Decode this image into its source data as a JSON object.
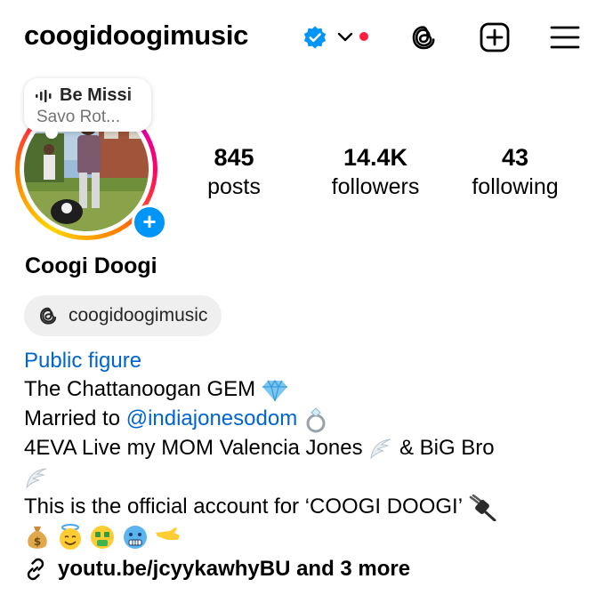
{
  "header": {
    "username": "coogidoogimusic",
    "icons": [
      "verified-badge-icon",
      "chevron-down-icon",
      "notification-dot",
      "threads-icon",
      "create-post-icon",
      "menu-icon"
    ]
  },
  "note": {
    "title": "Be Missi",
    "subtitle": "Savo Rot..."
  },
  "stats": {
    "posts": {
      "value": "845",
      "label": "posts"
    },
    "followers": {
      "value": "14.4K",
      "label": "followers"
    },
    "following": {
      "value": "43",
      "label": "following"
    }
  },
  "profile": {
    "display_name": "Coogi Doogi",
    "threads_handle": "coogidoogimusic",
    "category": "Public figure"
  },
  "bio": {
    "line1": "The Chattanoogan GEM",
    "line2_prefix": "Married to ",
    "line2_mention": "@indiajonesodom",
    "line3_a": "4EVA Live my MOM Valencia Jones",
    "line3_b": " & BiG Bro",
    "line5": "This is the official account for ‘COOGI DOOGI’",
    "emojis": [
      "gem",
      "ring",
      "angel-wing",
      "plug",
      "money-bag",
      "halo-face",
      "money-mouth-face",
      "cold-face",
      "saluting-hand"
    ]
  },
  "links": {
    "text": "youtu.be/jcyykawhyBU and 3 more"
  },
  "colors": {
    "link_blue": "#0064d1",
    "verified_blue": "#0095f6",
    "notification_red": "#ff1f3d",
    "chip_bg": "#efefef"
  }
}
